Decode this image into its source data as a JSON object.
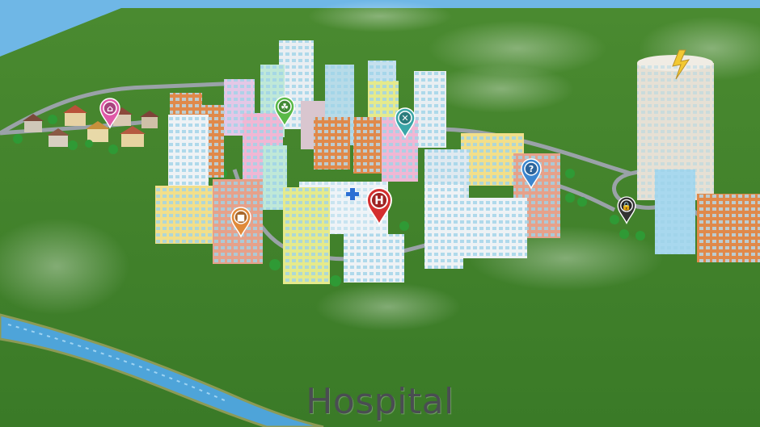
{
  "selected_location": "Hospital",
  "pins": [
    {
      "name": "home",
      "color": "#e05aa8",
      "glyph": "⌂"
    },
    {
      "name": "park",
      "color": "#59b947",
      "glyph": "☘"
    },
    {
      "name": "restaurant",
      "color": "#3aa6a8",
      "glyph": "✕"
    },
    {
      "name": "help",
      "color": "#3b86cf",
      "glyph": "?"
    },
    {
      "name": "shop",
      "color": "#e08a3a",
      "glyph": "■"
    },
    {
      "name": "hospital",
      "color": "#d42f2f",
      "glyph": "H"
    },
    {
      "name": "lock",
      "color": "#333333",
      "glyph": "🔒"
    }
  ],
  "colors": {
    "grass": "#3f7f2a",
    "sky": "#6fb7e6",
    "river": "#4ea4d9",
    "road": "#9aa2a8"
  }
}
